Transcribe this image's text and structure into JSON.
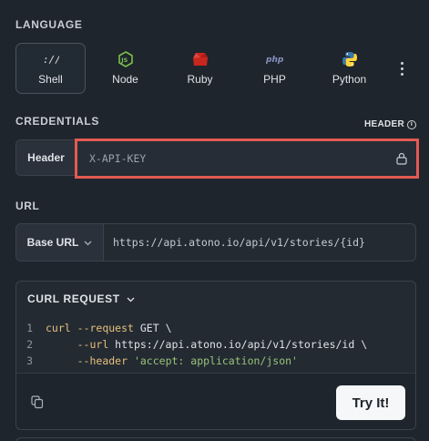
{
  "language": {
    "section_label": "LANGUAGE",
    "items": [
      {
        "label": "Shell",
        "icon": "shell-icon",
        "active": true
      },
      {
        "label": "Node",
        "icon": "nodejs-icon",
        "active": false
      },
      {
        "label": "Ruby",
        "icon": "ruby-icon",
        "active": false
      },
      {
        "label": "PHP",
        "icon": "php-icon",
        "active": false
      },
      {
        "label": "Python",
        "icon": "python-icon",
        "active": false
      }
    ],
    "more_icon": "more-vertical-icon"
  },
  "credentials": {
    "section_label": "CREDENTIALS",
    "toggle_label": "HEADER",
    "toggle_icon": "info-icon",
    "field_label": "Header",
    "placeholder": "X-API-KEY",
    "value": "",
    "lock_icon": "lock-icon",
    "highlight_color": "#e25b52"
  },
  "url": {
    "section_label": "URL",
    "base_label": "Base URL",
    "value": "https://api.atono.io/api/v1/stories/{id}"
  },
  "curl": {
    "title": "CURL REQUEST",
    "lines": [
      {
        "num": "1",
        "parts": [
          {
            "cls": "kw",
            "text": "curl"
          },
          {
            "cls": "tx",
            "text": " "
          },
          {
            "cls": "fl",
            "text": "--request"
          },
          {
            "cls": "tx",
            "text": " GET \\"
          }
        ]
      },
      {
        "num": "2",
        "parts": [
          {
            "cls": "tx",
            "text": "     "
          },
          {
            "cls": "fl",
            "text": "--url"
          },
          {
            "cls": "tx",
            "text": " https://api.atono.io/api/v1/stories/id \\"
          }
        ]
      },
      {
        "num": "3",
        "parts": [
          {
            "cls": "tx",
            "text": "     "
          },
          {
            "cls": "fl",
            "text": "--header"
          },
          {
            "cls": "tx",
            "text": " "
          },
          {
            "cls": "st",
            "text": "'accept: application/json'"
          }
        ]
      }
    ],
    "copy_icon": "copy-icon",
    "try_label": "Try It!"
  },
  "colors": {
    "background": "#1f252d",
    "border": "#3a424d",
    "keyword": "#e6c07b",
    "string": "#98c379"
  }
}
